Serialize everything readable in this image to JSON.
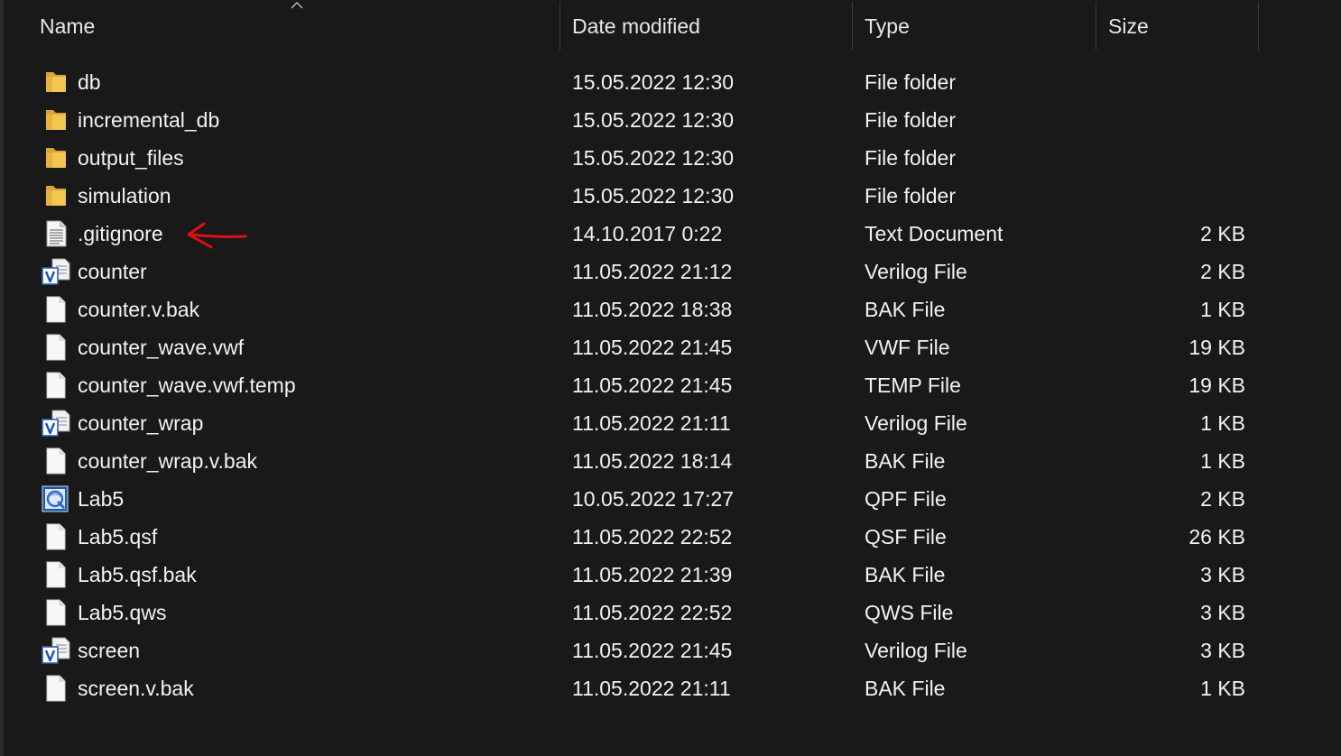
{
  "columns": {
    "name": "Name",
    "date": "Date modified",
    "type": "Type",
    "size": "Size"
  },
  "colors": {
    "background": "#191919",
    "text": "#f2f2f2",
    "folder": "#f0c14b",
    "annotation_arrow": "#e01010"
  },
  "files": [
    {
      "name": "db",
      "date": "15.05.2022 12:30",
      "type": "File folder",
      "size": "",
      "icon": "folder-icon"
    },
    {
      "name": "incremental_db",
      "date": "15.05.2022 12:30",
      "type": "File folder",
      "size": "",
      "icon": "folder-icon"
    },
    {
      "name": "output_files",
      "date": "15.05.2022 12:30",
      "type": "File folder",
      "size": "",
      "icon": "folder-icon"
    },
    {
      "name": "simulation",
      "date": "15.05.2022 12:30",
      "type": "File folder",
      "size": "",
      "icon": "folder-icon"
    },
    {
      "name": ".gitignore",
      "date": "14.10.2017 0:22",
      "type": "Text Document",
      "size": "2 KB",
      "icon": "text-document-icon"
    },
    {
      "name": "counter",
      "date": "11.05.2022 21:12",
      "type": "Verilog File",
      "size": "2 KB",
      "icon": "verilog-file-icon"
    },
    {
      "name": "counter.v.bak",
      "date": "11.05.2022 18:38",
      "type": "BAK File",
      "size": "1 KB",
      "icon": "blank-file-icon"
    },
    {
      "name": "counter_wave.vwf",
      "date": "11.05.2022 21:45",
      "type": "VWF File",
      "size": "19 KB",
      "icon": "blank-file-icon"
    },
    {
      "name": "counter_wave.vwf.temp",
      "date": "11.05.2022 21:45",
      "type": "TEMP File",
      "size": "19 KB",
      "icon": "blank-file-icon"
    },
    {
      "name": "counter_wrap",
      "date": "11.05.2022 21:11",
      "type": "Verilog File",
      "size": "1 KB",
      "icon": "verilog-file-icon"
    },
    {
      "name": "counter_wrap.v.bak",
      "date": "11.05.2022 18:14",
      "type": "BAK File",
      "size": "1 KB",
      "icon": "blank-file-icon"
    },
    {
      "name": "Lab5",
      "date": "10.05.2022 17:27",
      "type": "QPF File",
      "size": "2 KB",
      "icon": "quartus-project-icon"
    },
    {
      "name": "Lab5.qsf",
      "date": "11.05.2022 22:52",
      "type": "QSF File",
      "size": "26 KB",
      "icon": "blank-file-icon"
    },
    {
      "name": "Lab5.qsf.bak",
      "date": "11.05.2022 21:39",
      "type": "BAK File",
      "size": "3 KB",
      "icon": "blank-file-icon"
    },
    {
      "name": "Lab5.qws",
      "date": "11.05.2022 22:52",
      "type": "QWS File",
      "size": "3 KB",
      "icon": "blank-file-icon"
    },
    {
      "name": "screen",
      "date": "11.05.2022 21:45",
      "type": "Verilog File",
      "size": "3 KB",
      "icon": "verilog-file-icon"
    },
    {
      "name": "screen.v.bak",
      "date": "11.05.2022 21:11",
      "type": "BAK File",
      "size": "1 KB",
      "icon": "blank-file-icon"
    }
  ]
}
